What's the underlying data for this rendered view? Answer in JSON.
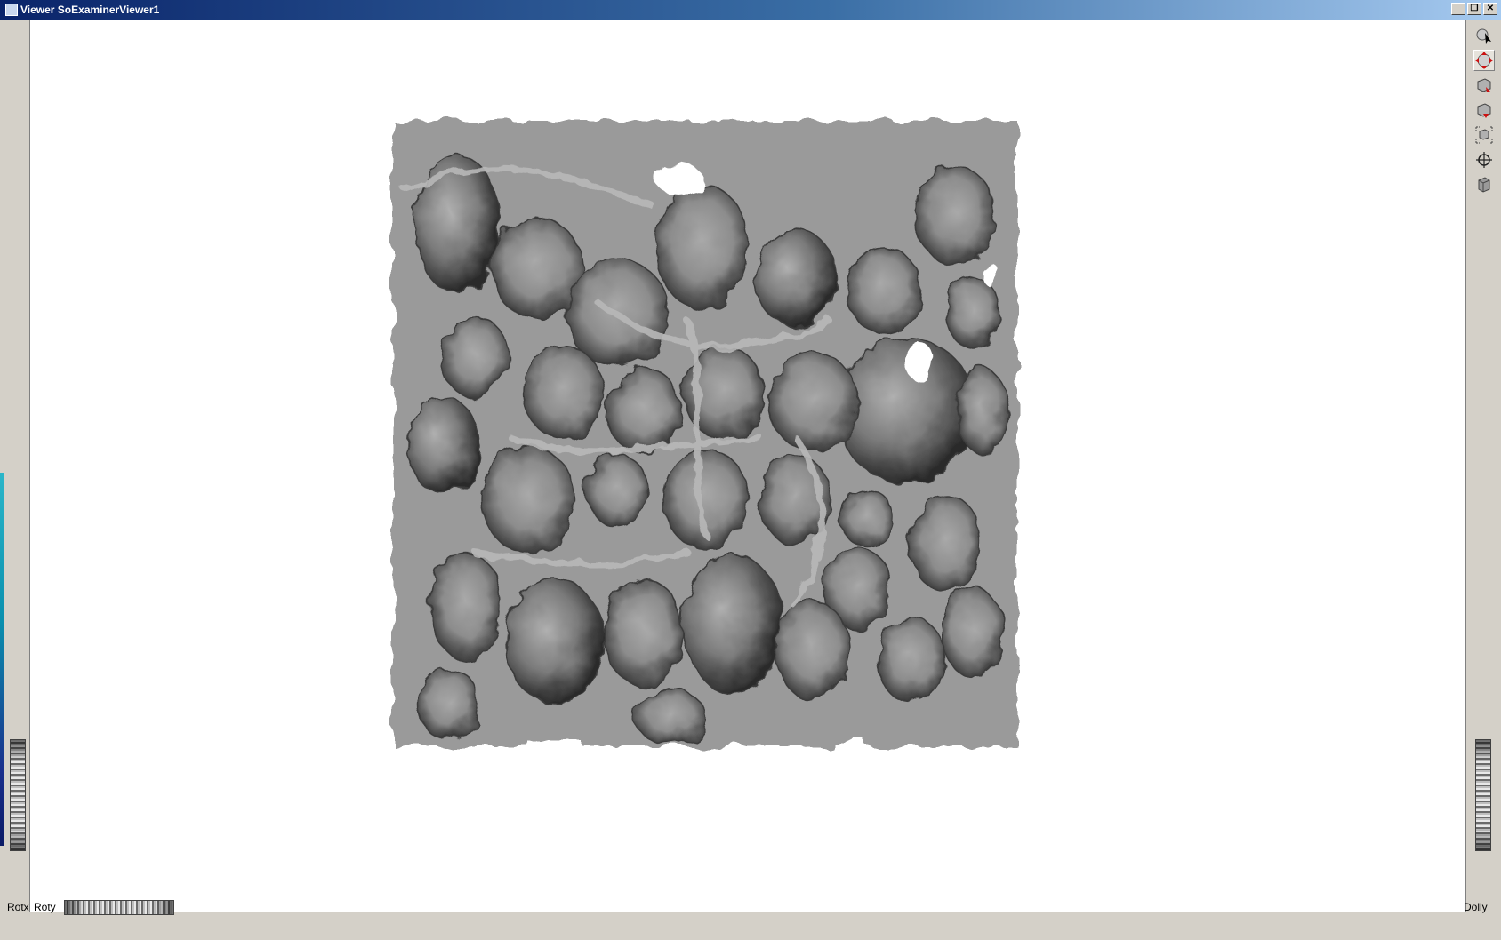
{
  "window": {
    "title": "Viewer SoExaminerViewer1",
    "buttons": [
      "_",
      "❐",
      "✕"
    ]
  },
  "toolbar": {
    "tools": [
      {
        "name": "pick-mode-icon",
        "active": false
      },
      {
        "name": "view-mode-icon",
        "active": true
      },
      {
        "name": "home-icon",
        "active": false
      },
      {
        "name": "set-home-icon",
        "active": false
      },
      {
        "name": "view-all-icon",
        "active": false
      },
      {
        "name": "seek-icon",
        "active": false
      },
      {
        "name": "projection-icon",
        "active": false
      }
    ]
  },
  "thumbwheels": {
    "rotx_label": "Rotx",
    "roty_label": "Roty",
    "dolly_label": "Dolly"
  },
  "scene": {
    "object": "gray porous trabecular mesh surface",
    "surface_color": "#9b9b9b",
    "background_color": "#ffffff"
  }
}
